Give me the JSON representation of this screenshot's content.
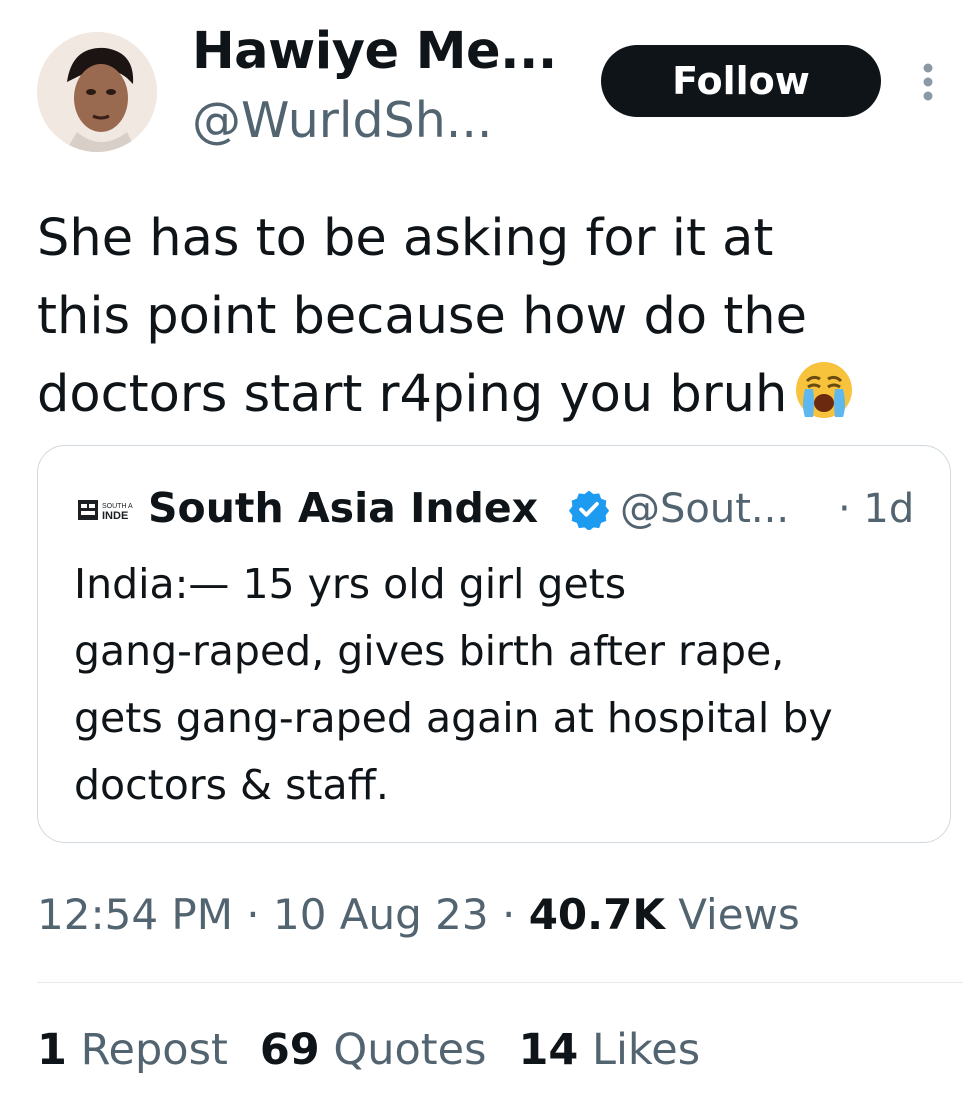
{
  "author": {
    "display_name": "Hawiye Me...",
    "handle": "@WurldSh..."
  },
  "follow_label": "Follow",
  "tweet": {
    "text": "She has to be asking for it at\nthis point because how do the\ndoctors start r4ping you bruh",
    "emoji": "loudly-crying-face"
  },
  "quoted": {
    "logo_text_top": "SOUTH A",
    "logo_text_bottom": "INDE",
    "name": "South Asia Index",
    "handle": "@Sout...",
    "time": "· 1d",
    "text": "India:— 15 yrs old girl gets\ngang-raped, gives birth after rape,\ngets gang-raped again at hospital by\ndoctors & staff."
  },
  "meta": {
    "time": "12:54 PM",
    "sep1": " · ",
    "date": "10 Aug 23",
    "sep2": " · ",
    "views_count": "40.7K",
    "views_label": " Views"
  },
  "stats": [
    {
      "count": "1",
      "label": "Repost"
    },
    {
      "count": "69",
      "label": "Quotes"
    },
    {
      "count": "14",
      "label": "Likes"
    }
  ],
  "colors": {
    "text": "#0f1419",
    "secondary": "#536471",
    "verified": "#1d9bf0",
    "button_bg": "#0f1419",
    "border": "#cfd9de"
  }
}
